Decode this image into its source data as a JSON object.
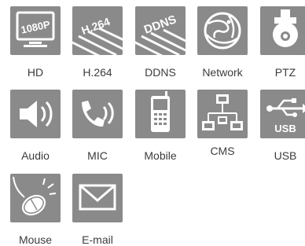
{
  "colors": {
    "tile_bg": "#8a8a8a",
    "icon_fg": "#ffffff",
    "label": "#3c3c3c"
  },
  "features": [
    {
      "label": "HD",
      "icon": "hd-1080p-monitor-icon",
      "badge": "1080P"
    },
    {
      "label": "H.264",
      "icon": "h264-codec-icon",
      "badge": "H.264"
    },
    {
      "label": "DDNS",
      "icon": "ddns-icon",
      "badge": "DDNS"
    },
    {
      "label": "Network",
      "icon": "globe-network-icon"
    },
    {
      "label": "PTZ",
      "icon": "ptz-dome-camera-icon"
    },
    {
      "label": "Audio",
      "icon": "speaker-audio-icon"
    },
    {
      "label": "MIC",
      "icon": "phone-mic-icon"
    },
    {
      "label": "Mobile",
      "icon": "mobile-phone-icon"
    },
    {
      "label": "CMS",
      "icon": "cms-network-icon"
    },
    {
      "label": "USB",
      "icon": "usb-icon",
      "badge": "USB"
    },
    {
      "label": "Mouse",
      "icon": "mouse-icon"
    },
    {
      "label": "E-mail",
      "icon": "envelope-email-icon"
    }
  ]
}
